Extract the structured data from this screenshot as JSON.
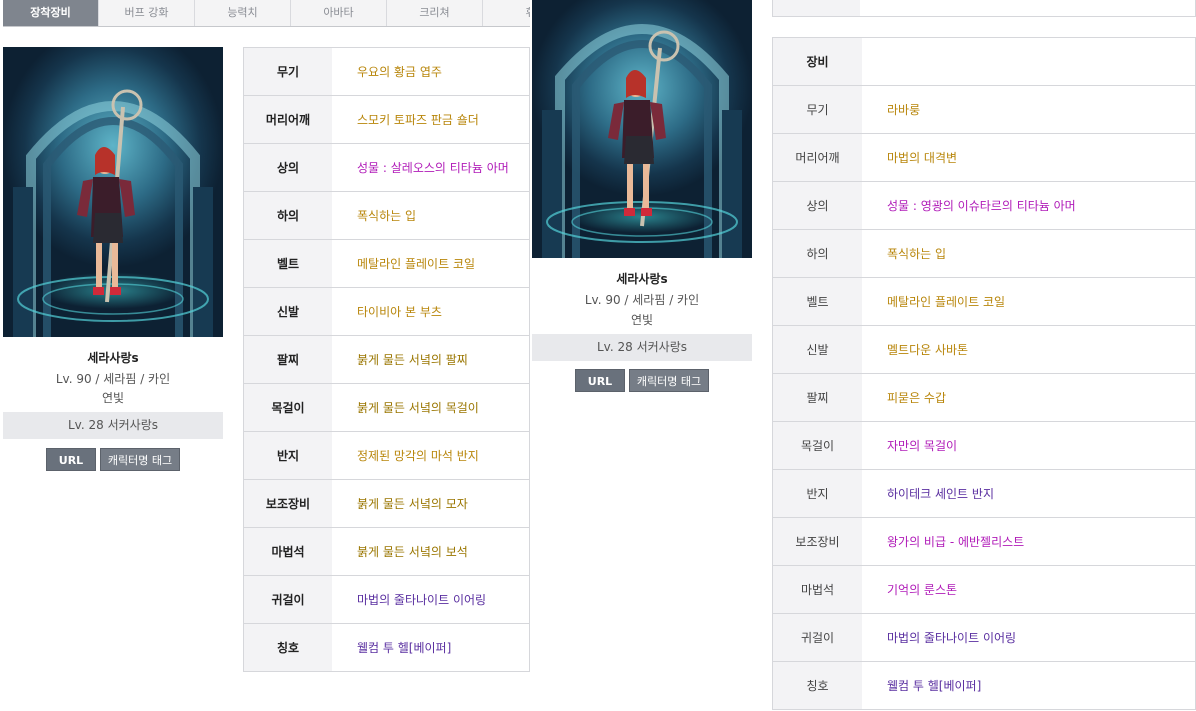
{
  "tabs": [
    "장착장비",
    "버프 강화",
    "능력치",
    "아바타",
    "크리쳐",
    "휘"
  ],
  "active_tab": 0,
  "character": {
    "name": "세라사랑s",
    "level_class": "Lv. 90 / 세라핌 / 카인",
    "guild": "연빛",
    "adventure": "Lv. 28 서커사랑s",
    "url_button": "URL",
    "tag_button": "캐릭터명 태그"
  },
  "colors": {
    "rare": "#b8860b",
    "unique": "#b01bb8",
    "legendary": "#b25e00",
    "epic": "#b8860b",
    "set": "#5a2fa0",
    "chronicle": "#9a7600",
    "tab_active_bg": "#7f858e",
    "button_bg": "#767d87"
  },
  "equipment_1": [
    {
      "slot": "무기",
      "item": "우요의 황금 엽주",
      "color": "#b8860b"
    },
    {
      "slot": "머리어깨",
      "item": "스모키 토파즈 판금 숄더",
      "color": "#b8860b"
    },
    {
      "slot": "상의",
      "item": "성물 : 살레오스의 티타늄 아머",
      "color": "#b01bb8"
    },
    {
      "slot": "하의",
      "item": "폭식하는 입",
      "color": "#b8860b"
    },
    {
      "slot": "벨트",
      "item": "메탈라인 플레이트 코일",
      "color": "#b8860b"
    },
    {
      "slot": "신발",
      "item": "타이비아 본 부츠",
      "color": "#b8860b"
    },
    {
      "slot": "팔찌",
      "item": "붉게 물든 서녘의 팔찌",
      "color": "#9a7600"
    },
    {
      "slot": "목걸이",
      "item": "붉게 물든 서녘의 목걸이",
      "color": "#9a7600"
    },
    {
      "slot": "반지",
      "item": "정제된 망각의 마석 반지",
      "color": "#b8860b"
    },
    {
      "slot": "보조장비",
      "item": "붉게 물든 서녘의 모자",
      "color": "#9a7600"
    },
    {
      "slot": "마법석",
      "item": "붉게 물든 서녘의 보석",
      "color": "#9a7600"
    },
    {
      "slot": "귀걸이",
      "item": "마법의 줄타나이트 이어링",
      "color": "#5a2fa0"
    },
    {
      "slot": "칭호",
      "item": "웰컴 투 헬[베이퍼]",
      "color": "#5a2fa0"
    }
  ],
  "equipment_2_header": "장비",
  "equipment_2": [
    {
      "slot": "무기",
      "item": "라바룽",
      "color": "#b8860b"
    },
    {
      "slot": "머리어깨",
      "item": "마법의 대격변",
      "color": "#b8860b"
    },
    {
      "slot": "상의",
      "item": "성물 : 영광의 이슈타르의 티타늄 아머",
      "color": "#b01bb8"
    },
    {
      "slot": "하의",
      "item": "폭식하는 입",
      "color": "#b8860b"
    },
    {
      "slot": "벨트",
      "item": "메탈라인 플레이트 코일",
      "color": "#b8860b"
    },
    {
      "slot": "신발",
      "item": "멜트다운 사바톤",
      "color": "#b8860b"
    },
    {
      "slot": "팔찌",
      "item": "피묻은 수갑",
      "color": "#b8860b"
    },
    {
      "slot": "목걸이",
      "item": "자만의 목걸이",
      "color": "#b01bb8"
    },
    {
      "slot": "반지",
      "item": "하이테크 세인트 반지",
      "color": "#5a2fa0"
    },
    {
      "slot": "보조장비",
      "item": "왕가의 비급 - 에반젤리스트",
      "color": "#b01bb8"
    },
    {
      "slot": "마법석",
      "item": "기억의 룬스톤",
      "color": "#b01bb8"
    },
    {
      "slot": "귀걸이",
      "item": "마법의 줄타나이트 이어링",
      "color": "#5a2fa0"
    },
    {
      "slot": "칭호",
      "item": "웰컴 투 헬[베이퍼]",
      "color": "#5a2fa0"
    }
  ]
}
